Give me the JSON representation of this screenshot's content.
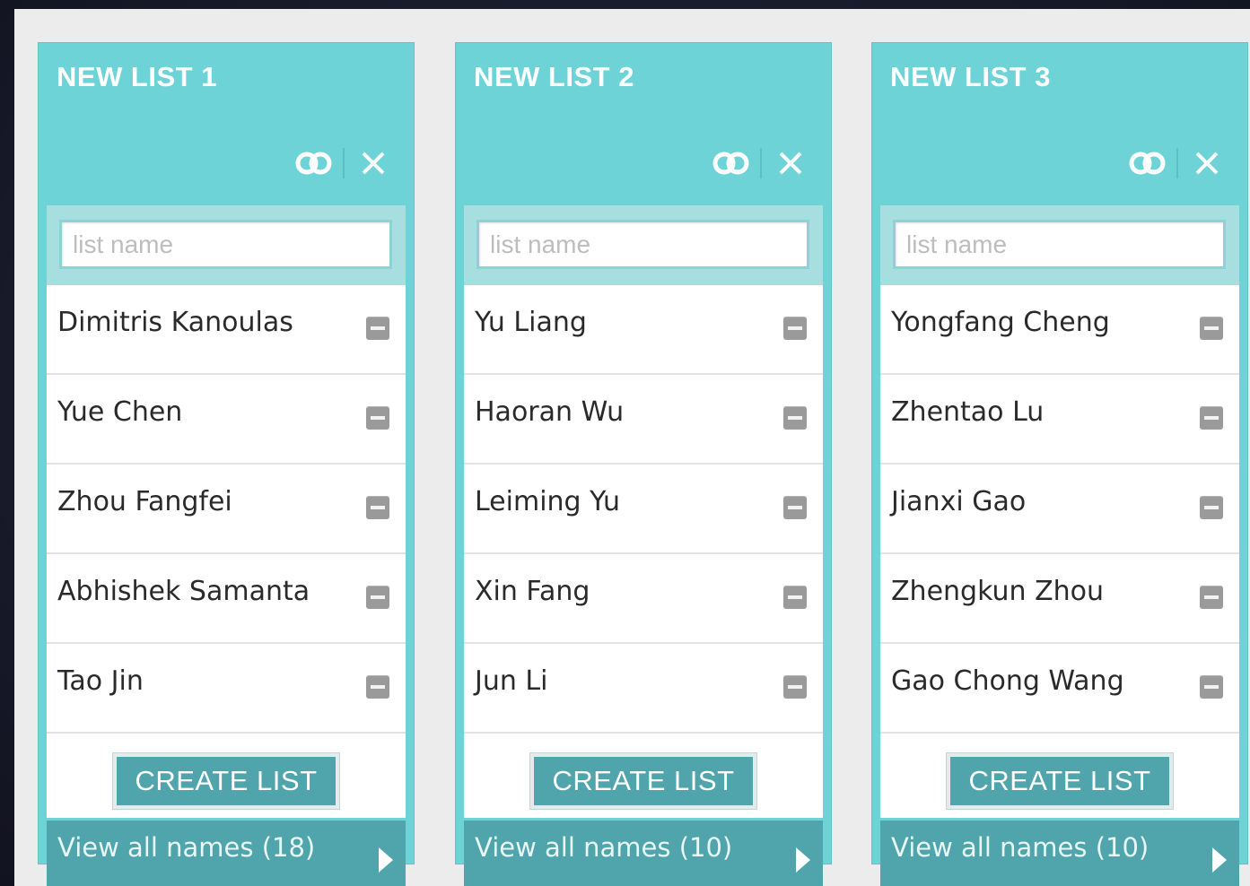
{
  "panels": [
    {
      "title": "NEW LIST 1",
      "search_placeholder": "list name",
      "names": [
        "Dimitris Kanoulas",
        "Yue Chen",
        "Zhou Fangfei",
        "Abhishek Samanta",
        "Tao Jin"
      ],
      "create_label": "CREATE LIST",
      "view_all_label": "View all names (18)"
    },
    {
      "title": "NEW LIST 2",
      "search_placeholder": "list name",
      "names": [
        "Yu Liang",
        "Haoran Wu",
        "Leiming Yu",
        "Xin Fang",
        "Jun Li"
      ],
      "create_label": "CREATE LIST",
      "view_all_label": "View all names (10)"
    },
    {
      "title": "NEW LIST 3",
      "search_placeholder": "list name",
      "names": [
        "Yongfang Cheng",
        "Zhentao Lu",
        "Jianxi Gao",
        "Zhengkun Zhou",
        "Gao Chong Wang"
      ],
      "create_label": "CREATE LIST",
      "view_all_label": "View all names (10)"
    }
  ],
  "icons": {
    "merge": "merge-lists-icon",
    "close": "close-icon",
    "remove": "remove-name-icon",
    "expand": "play-arrow-icon"
  },
  "colors": {
    "panel_bg": "#6dd3d7",
    "accent_dark": "#4fa5ab",
    "search_strip": "#a7dfe1",
    "page_bg": "#ececec"
  }
}
